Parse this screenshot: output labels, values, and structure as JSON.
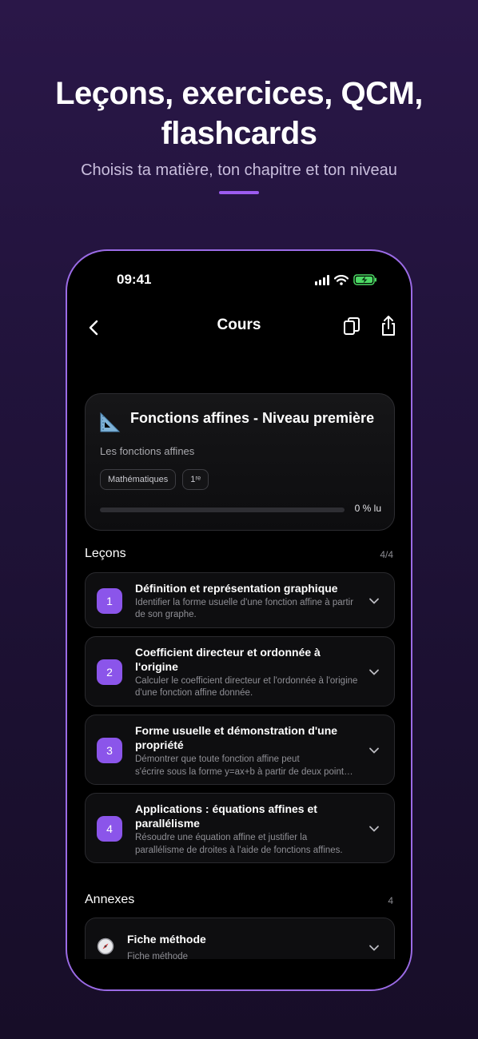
{
  "hero": {
    "title": "Leçons, exercices, QCM, flashcards",
    "subtitle": "Choisis ta matière, ton chapitre et ton niveau"
  },
  "status_bar": {
    "time": "09:41"
  },
  "nav": {
    "title": "Cours"
  },
  "course": {
    "title": "Fonctions affines - Niveau première",
    "subtitle": "Les fonctions affines",
    "tags": [
      "Mathématiques",
      "1ʳᵉ"
    ],
    "progress_label": "0 % lu",
    "progress_fraction": 0
  },
  "lessons_section": {
    "title": "Leçons",
    "count": "4/4"
  },
  "lessons": [
    {
      "num": "1",
      "title": "Définition et représentation graphique",
      "desc": "Identifier la forme usuelle d'une fonction affine à partir de son graphe."
    },
    {
      "num": "2",
      "title": "Coefficient directeur et ordonnée à l'origine",
      "desc": "Calculer le coefficient directeur et l'ordonnée à l'origine d'une fonction affine donnée."
    },
    {
      "num": "3",
      "title": "Forme usuelle et démonstration d'une propriété",
      "desc1": "Démontrer que toute fonction affine peut",
      "desc2": "s'écrire sous la forme y=ax+b à partir de deux points distincts."
    },
    {
      "num": "4",
      "title": "Applications : équations affines et parallélisme",
      "desc1": "Résoudre une équation affine et justifier la",
      "desc2": "parallélisme de droites à l'aide de fonctions affines."
    }
  ],
  "annexes_section": {
    "title": "Annexes",
    "count": "4"
  },
  "annex": {
    "title": "Fiche méthode",
    "subtitle": "Fiche méthode"
  },
  "colors": {
    "accent": "#8b55ea",
    "battery": "#4cd964",
    "frame": "#9b6be6"
  }
}
